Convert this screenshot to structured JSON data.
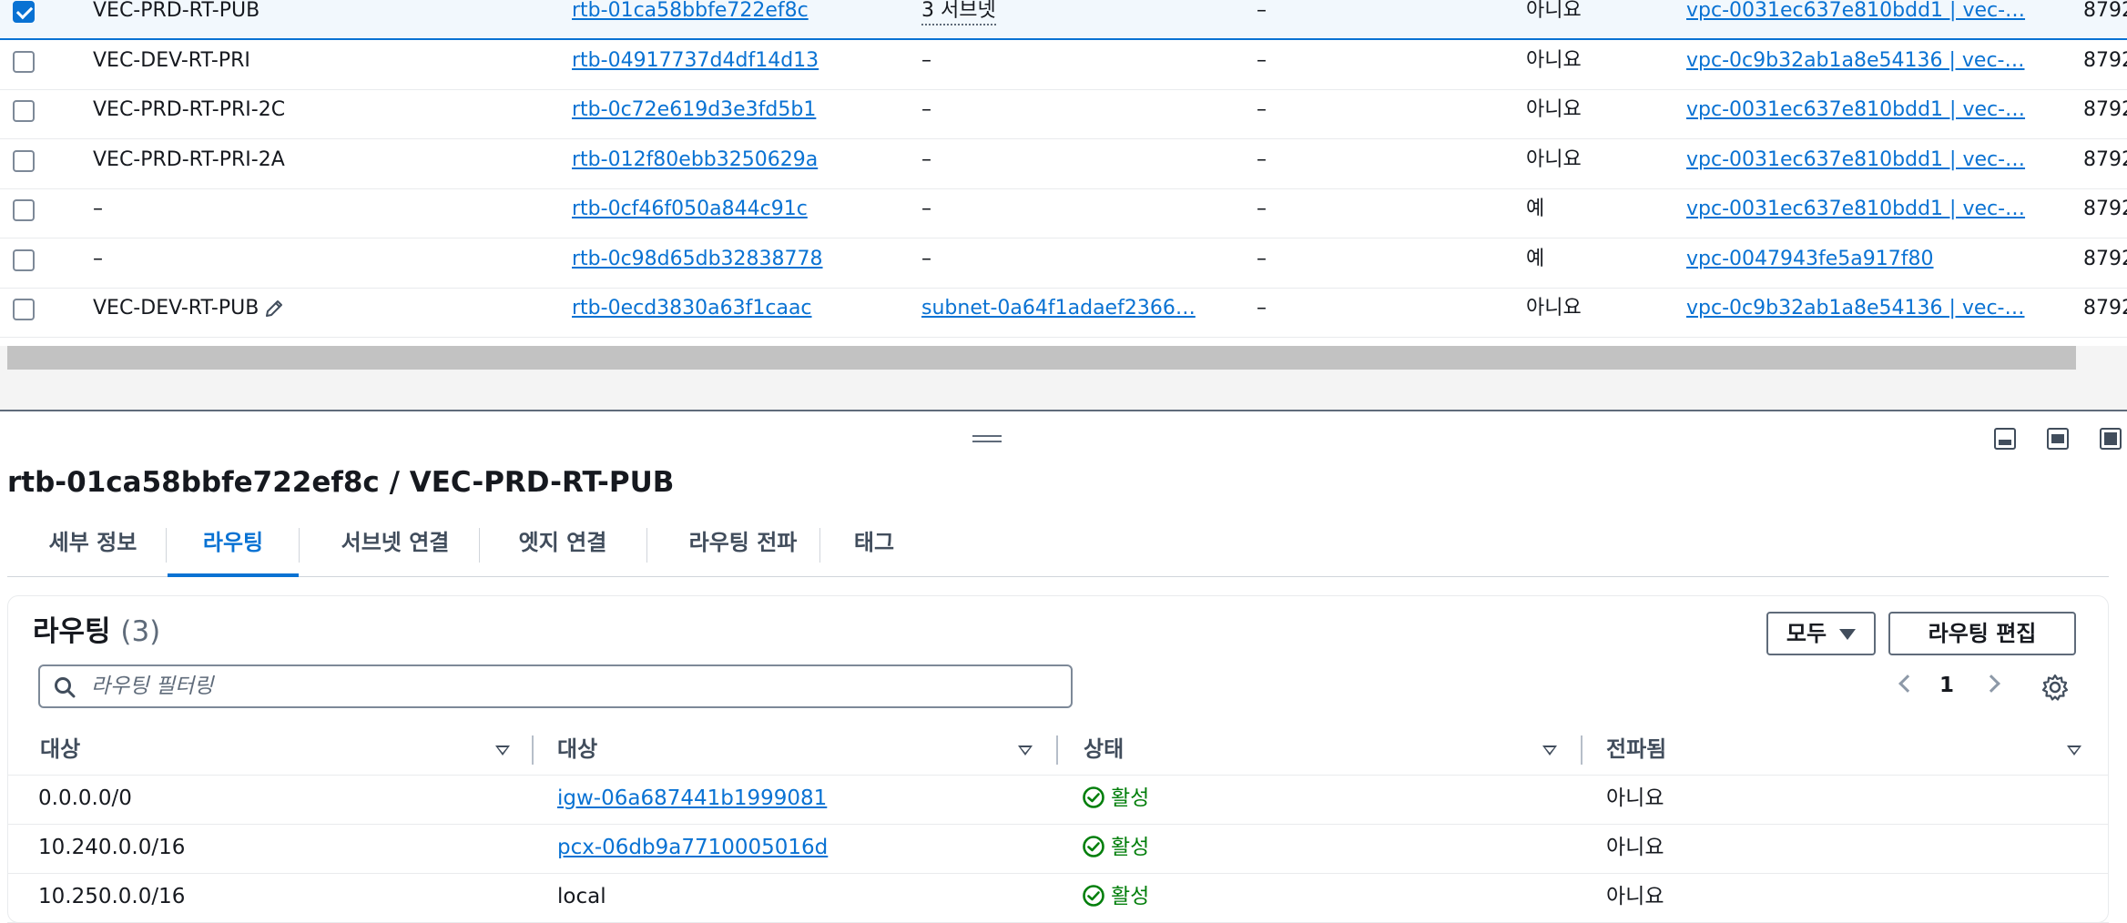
{
  "route_tables": {
    "rows": [
      {
        "selected": true,
        "name": "VEC-PRD-RT-PUB",
        "id": "rtb-01ca58bbfe722ef8c",
        "assoc": "3 서브넷",
        "assoc_type": "dotted",
        "edge": "–",
        "main": "아니요",
        "vpc": "vpc-0031ec637e810bdd1 | vec-…",
        "owner": "8792"
      },
      {
        "selected": false,
        "name": "VEC-DEV-RT-PRI",
        "id": "rtb-04917737d4df14d13",
        "assoc": "–",
        "assoc_type": "plain",
        "edge": "–",
        "main": "아니요",
        "vpc": "vpc-0c9b32ab1a8e54136 | vec-…",
        "owner": "8792"
      },
      {
        "selected": false,
        "name": "VEC-PRD-RT-PRI-2C",
        "id": "rtb-0c72e619d3e3fd5b1",
        "assoc": "–",
        "assoc_type": "plain",
        "edge": "–",
        "main": "아니요",
        "vpc": "vpc-0031ec637e810bdd1 | vec-…",
        "owner": "8792"
      },
      {
        "selected": false,
        "name": "VEC-PRD-RT-PRI-2A",
        "id": "rtb-012f80ebb3250629a",
        "assoc": "–",
        "assoc_type": "plain",
        "edge": "–",
        "main": "아니요",
        "vpc": "vpc-0031ec637e810bdd1 | vec-…",
        "owner": "8792"
      },
      {
        "selected": false,
        "name": "–",
        "id": "rtb-0cf46f050a844c91c",
        "assoc": "–",
        "assoc_type": "plain",
        "edge": "–",
        "main": "예",
        "vpc": "vpc-0031ec637e810bdd1 | vec-…",
        "owner": "8792"
      },
      {
        "selected": false,
        "name": "–",
        "id": "rtb-0c98d65db32838778",
        "assoc": "–",
        "assoc_type": "plain",
        "edge": "–",
        "main": "예",
        "vpc": "vpc-0047943fe5a917f80",
        "owner": "8792"
      },
      {
        "selected": false,
        "name": "VEC-DEV-RT-PUB",
        "id": "rtb-0ecd3830a63f1caac",
        "assoc": "subnet-0a64f1adaef2366…",
        "assoc_type": "link",
        "edge": "–",
        "main": "아니요",
        "vpc": "vpc-0c9b32ab1a8e54136 | vec-…",
        "owner": "8792"
      }
    ]
  },
  "detail": {
    "title": "rtb-01ca58bbfe722ef8c / VEC-PRD-RT-PUB",
    "tabs": [
      "세부 정보",
      "라우팅",
      "서브넷 연결",
      "엣지 연결",
      "라우팅 전파",
      "태그"
    ],
    "active_tab": 1
  },
  "routes": {
    "title": "라우팅",
    "count": "(3)",
    "filter_button": "모두",
    "edit_button": "라우팅 편집",
    "search_placeholder": "라우팅 필터링",
    "page": "1",
    "columns": [
      "대상",
      "대상",
      "상태",
      "전파됨"
    ],
    "rows": [
      {
        "destination": "0.0.0.0/0",
        "target": "igw-06a687441b1999081",
        "target_link": true,
        "status": "활성",
        "propagated": "아니요"
      },
      {
        "destination": "10.240.0.0/16",
        "target": "pcx-06db9a7710005016d",
        "target_link": true,
        "status": "활성",
        "propagated": "아니요"
      },
      {
        "destination": "10.250.0.0/16",
        "target": "local",
        "target_link": false,
        "status": "활성",
        "propagated": "아니요"
      }
    ]
  },
  "colors": {
    "link": "#0972d3",
    "success": "#037f0c",
    "selected_bg": "#f2f8fd"
  },
  "icons": {
    "search": "search-icon",
    "settings": "gear-icon",
    "pencil": "pencil-icon",
    "status": "check-circle-icon"
  }
}
